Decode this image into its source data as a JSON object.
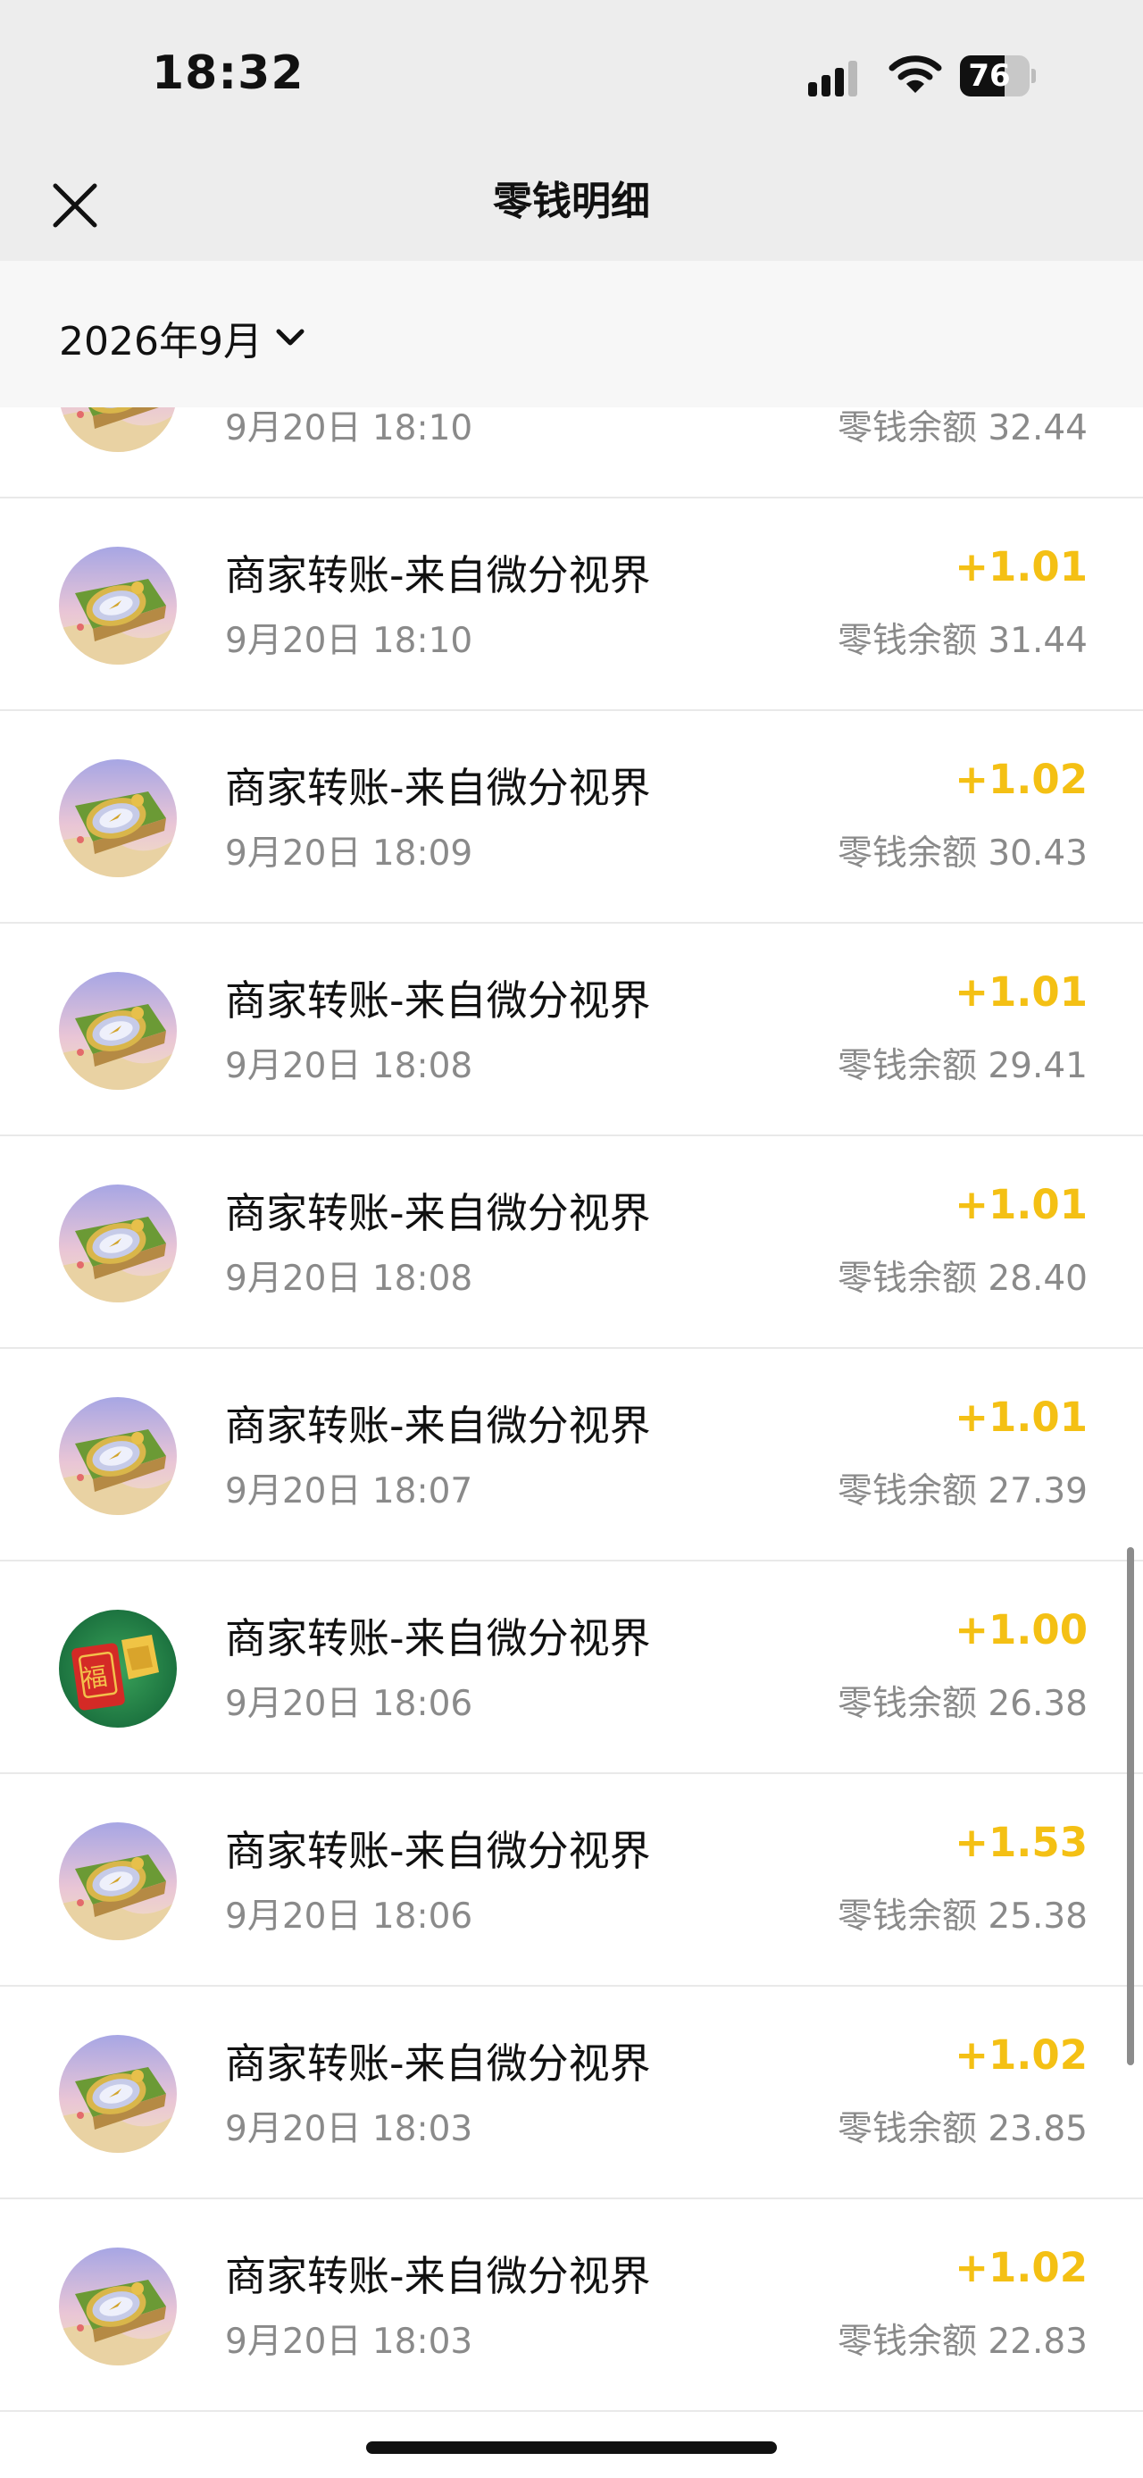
{
  "status_bar": {
    "time": "18:32",
    "battery_percent": "76",
    "battery_level": 0.76,
    "icons": [
      "cellular-signal-icon",
      "wifi-icon",
      "battery-icon"
    ]
  },
  "nav": {
    "title": "零钱明细",
    "close_icon": "close-icon"
  },
  "filter": {
    "month_label": "2026年9月",
    "dropdown_icon": "chevron-down-icon"
  },
  "colors": {
    "amount": "#f4c014",
    "secondary_text": "#8a8a8a",
    "header_bg": "#ededed"
  },
  "transactions": [
    {
      "title": "",
      "date": "9月20日 18:10",
      "amount": "",
      "balance": "零钱余额 32.44",
      "avatar": "compass-avatar"
    },
    {
      "title": "商家转账-来自微分视界",
      "date": "9月20日 18:10",
      "amount": "+1.01",
      "balance": "零钱余额 31.44",
      "avatar": "compass-avatar"
    },
    {
      "title": "商家转账-来自微分视界",
      "date": "9月20日 18:09",
      "amount": "+1.02",
      "balance": "零钱余额 30.43",
      "avatar": "compass-avatar"
    },
    {
      "title": "商家转账-来自微分视界",
      "date": "9月20日 18:08",
      "amount": "+1.01",
      "balance": "零钱余额 29.41",
      "avatar": "compass-avatar"
    },
    {
      "title": "商家转账-来自微分视界",
      "date": "9月20日 18:08",
      "amount": "+1.01",
      "balance": "零钱余额 28.40",
      "avatar": "compass-avatar"
    },
    {
      "title": "商家转账-来自微分视界",
      "date": "9月20日 18:07",
      "amount": "+1.01",
      "balance": "零钱余额 27.39",
      "avatar": "compass-avatar"
    },
    {
      "title": "商家转账-来自微分视界",
      "date": "9月20日 18:06",
      "amount": "+1.00",
      "balance": "零钱余额 26.38",
      "avatar": "red-envelope-avatar",
      "avatar_text": "福"
    },
    {
      "title": "商家转账-来自微分视界",
      "date": "9月20日 18:06",
      "amount": "+1.53",
      "balance": "零钱余额 25.38",
      "avatar": "compass-avatar"
    },
    {
      "title": "商家转账-来自微分视界",
      "date": "9月20日 18:03",
      "amount": "+1.02",
      "balance": "零钱余额 23.85",
      "avatar": "compass-avatar"
    },
    {
      "title": "商家转账-来自微分视界",
      "date": "9月20日 18:03",
      "amount": "+1.02",
      "balance": "零钱余额 22.83",
      "avatar": "compass-avatar"
    }
  ]
}
